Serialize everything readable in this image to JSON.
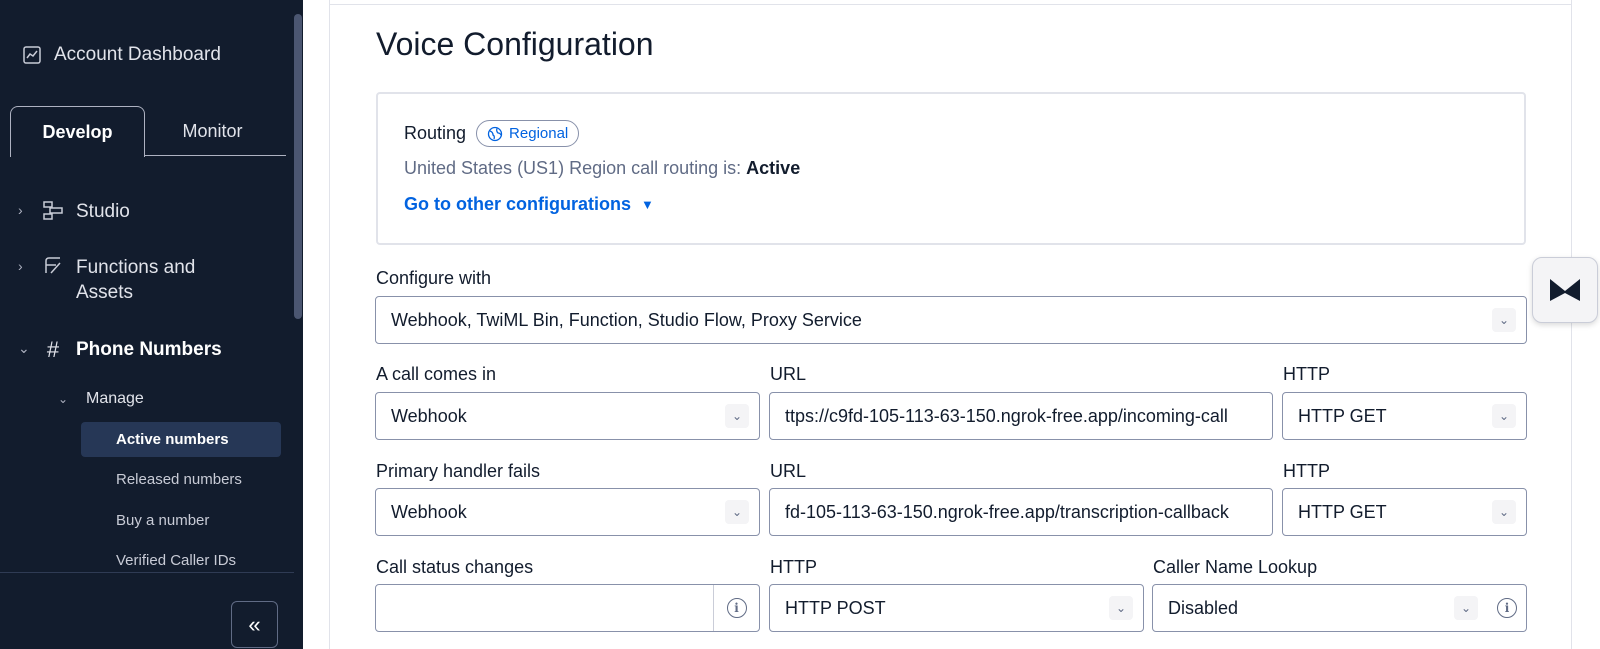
{
  "sidebar": {
    "account_dashboard": "Account Dashboard",
    "tabs": [
      {
        "label": "Develop"
      },
      {
        "label": "Monitor"
      }
    ],
    "nav": {
      "studio": "Studio",
      "functions": "Functions and\nAssets",
      "phone_numbers": "Phone Numbers",
      "manage": "Manage",
      "items": [
        {
          "label": "Active numbers"
        },
        {
          "label": "Released numbers"
        },
        {
          "label": "Buy a number"
        },
        {
          "label": "Verified Caller IDs"
        }
      ]
    },
    "collapse_label": "«"
  },
  "main": {
    "title": "Voice Configuration",
    "routing": {
      "label": "Routing",
      "badge": "Regional",
      "region_prefix": "United States (US1) Region call routing is: ",
      "region_status": "Active",
      "link": "Go to other configurations"
    },
    "configure_with": {
      "label": "Configure with",
      "value": "Webhook, TwiML Bin, Function, Studio Flow, Proxy Service"
    },
    "call_comes_in": {
      "label": "A call comes in",
      "value": "Webhook",
      "url_label": "URL",
      "url_value": "ttps://c9fd-105-113-63-150.ngrok-free.app/incoming-call",
      "http_label": "HTTP",
      "http_value": "HTTP GET"
    },
    "primary_fails": {
      "label": "Primary handler fails",
      "value": "Webhook",
      "url_label": "URL",
      "url_value": "fd-105-113-63-150.ngrok-free.app/transcription-callback",
      "http_label": "HTTP",
      "http_value": "HTTP GET"
    },
    "status_changes": {
      "label": "Call status changes",
      "value": "",
      "http_label": "HTTP",
      "http_value": "HTTP POST",
      "caller_lookup_label": "Caller Name Lookup",
      "caller_lookup_value": "Disabled"
    }
  },
  "icons": {
    "dashboard": "chart-icon",
    "studio": "flow-icon",
    "functions": "function-icon",
    "phone": "hash-icon",
    "regional": "globe-icon",
    "info": "info-icon",
    "widget": "chevron-logo-icon"
  },
  "colors": {
    "sidebar_bg": "#121c2d",
    "link": "#0263e0",
    "active_item_bg": "#263756"
  }
}
